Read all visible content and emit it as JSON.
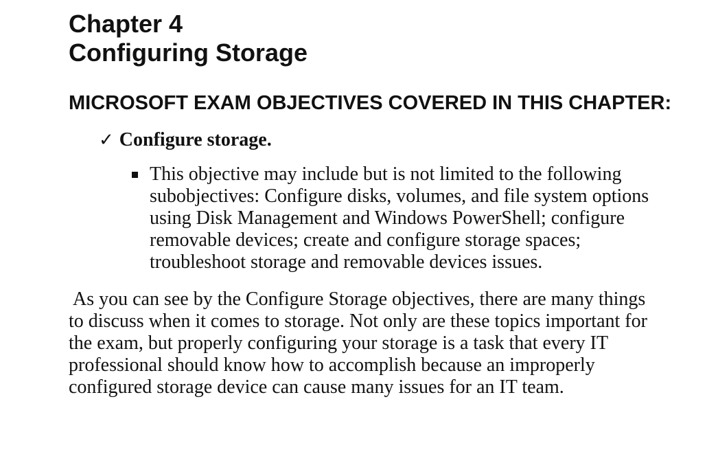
{
  "chapter": {
    "number_line": "Chapter 4",
    "title_line": "Configuring Storage"
  },
  "objectives": {
    "heading": "MICROSOFT EXAM OBJECTIVES COVERED IN THIS CHAPTER:",
    "items": [
      {
        "icon": "check-icon",
        "label": "Configure storage.",
        "subitems": [
          {
            "icon": "square-bullet-icon",
            "text": "This objective may include but is not limited to the following subobjectives: Configure disks, volumes, and file system options using Disk Management and Windows PowerShell; configure removable devices; create and configure storage spaces; troubleshoot storage and removable devices issues."
          }
        ]
      }
    ]
  },
  "body": {
    "intro_paragraph": "As you can see by the Configure Storage objectives, there are many things to discuss when it comes to storage. Not only are these topics important for the exam, but properly configuring your storage is a task that every IT professional should know how to accomplish because an improperly configured storage device can cause many issues for an IT team."
  }
}
